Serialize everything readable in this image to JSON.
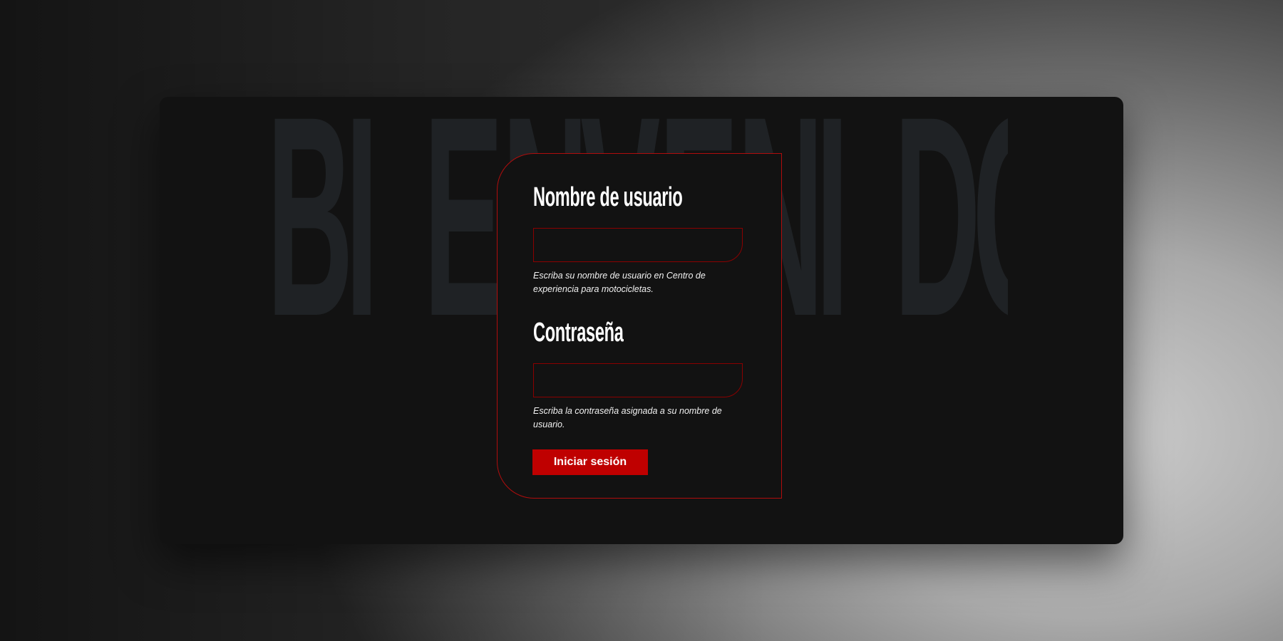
{
  "background_word": "BIENVENIDO",
  "form": {
    "username": {
      "label": "Nombre de usuario",
      "value": "",
      "placeholder": "",
      "hint": "Escriba su nombre de usuario en Centro de experiencia para motocicletas."
    },
    "password": {
      "label": "Contraseña",
      "value": "",
      "placeholder": "",
      "hint": "Escriba la contraseña asignada a su nombre de usuario."
    },
    "submit_label": "Iniciar sesión"
  },
  "colors": {
    "accent": "#bf0000",
    "panel": "#121212",
    "watermark": "#1f2225",
    "text": "#ffffff"
  }
}
